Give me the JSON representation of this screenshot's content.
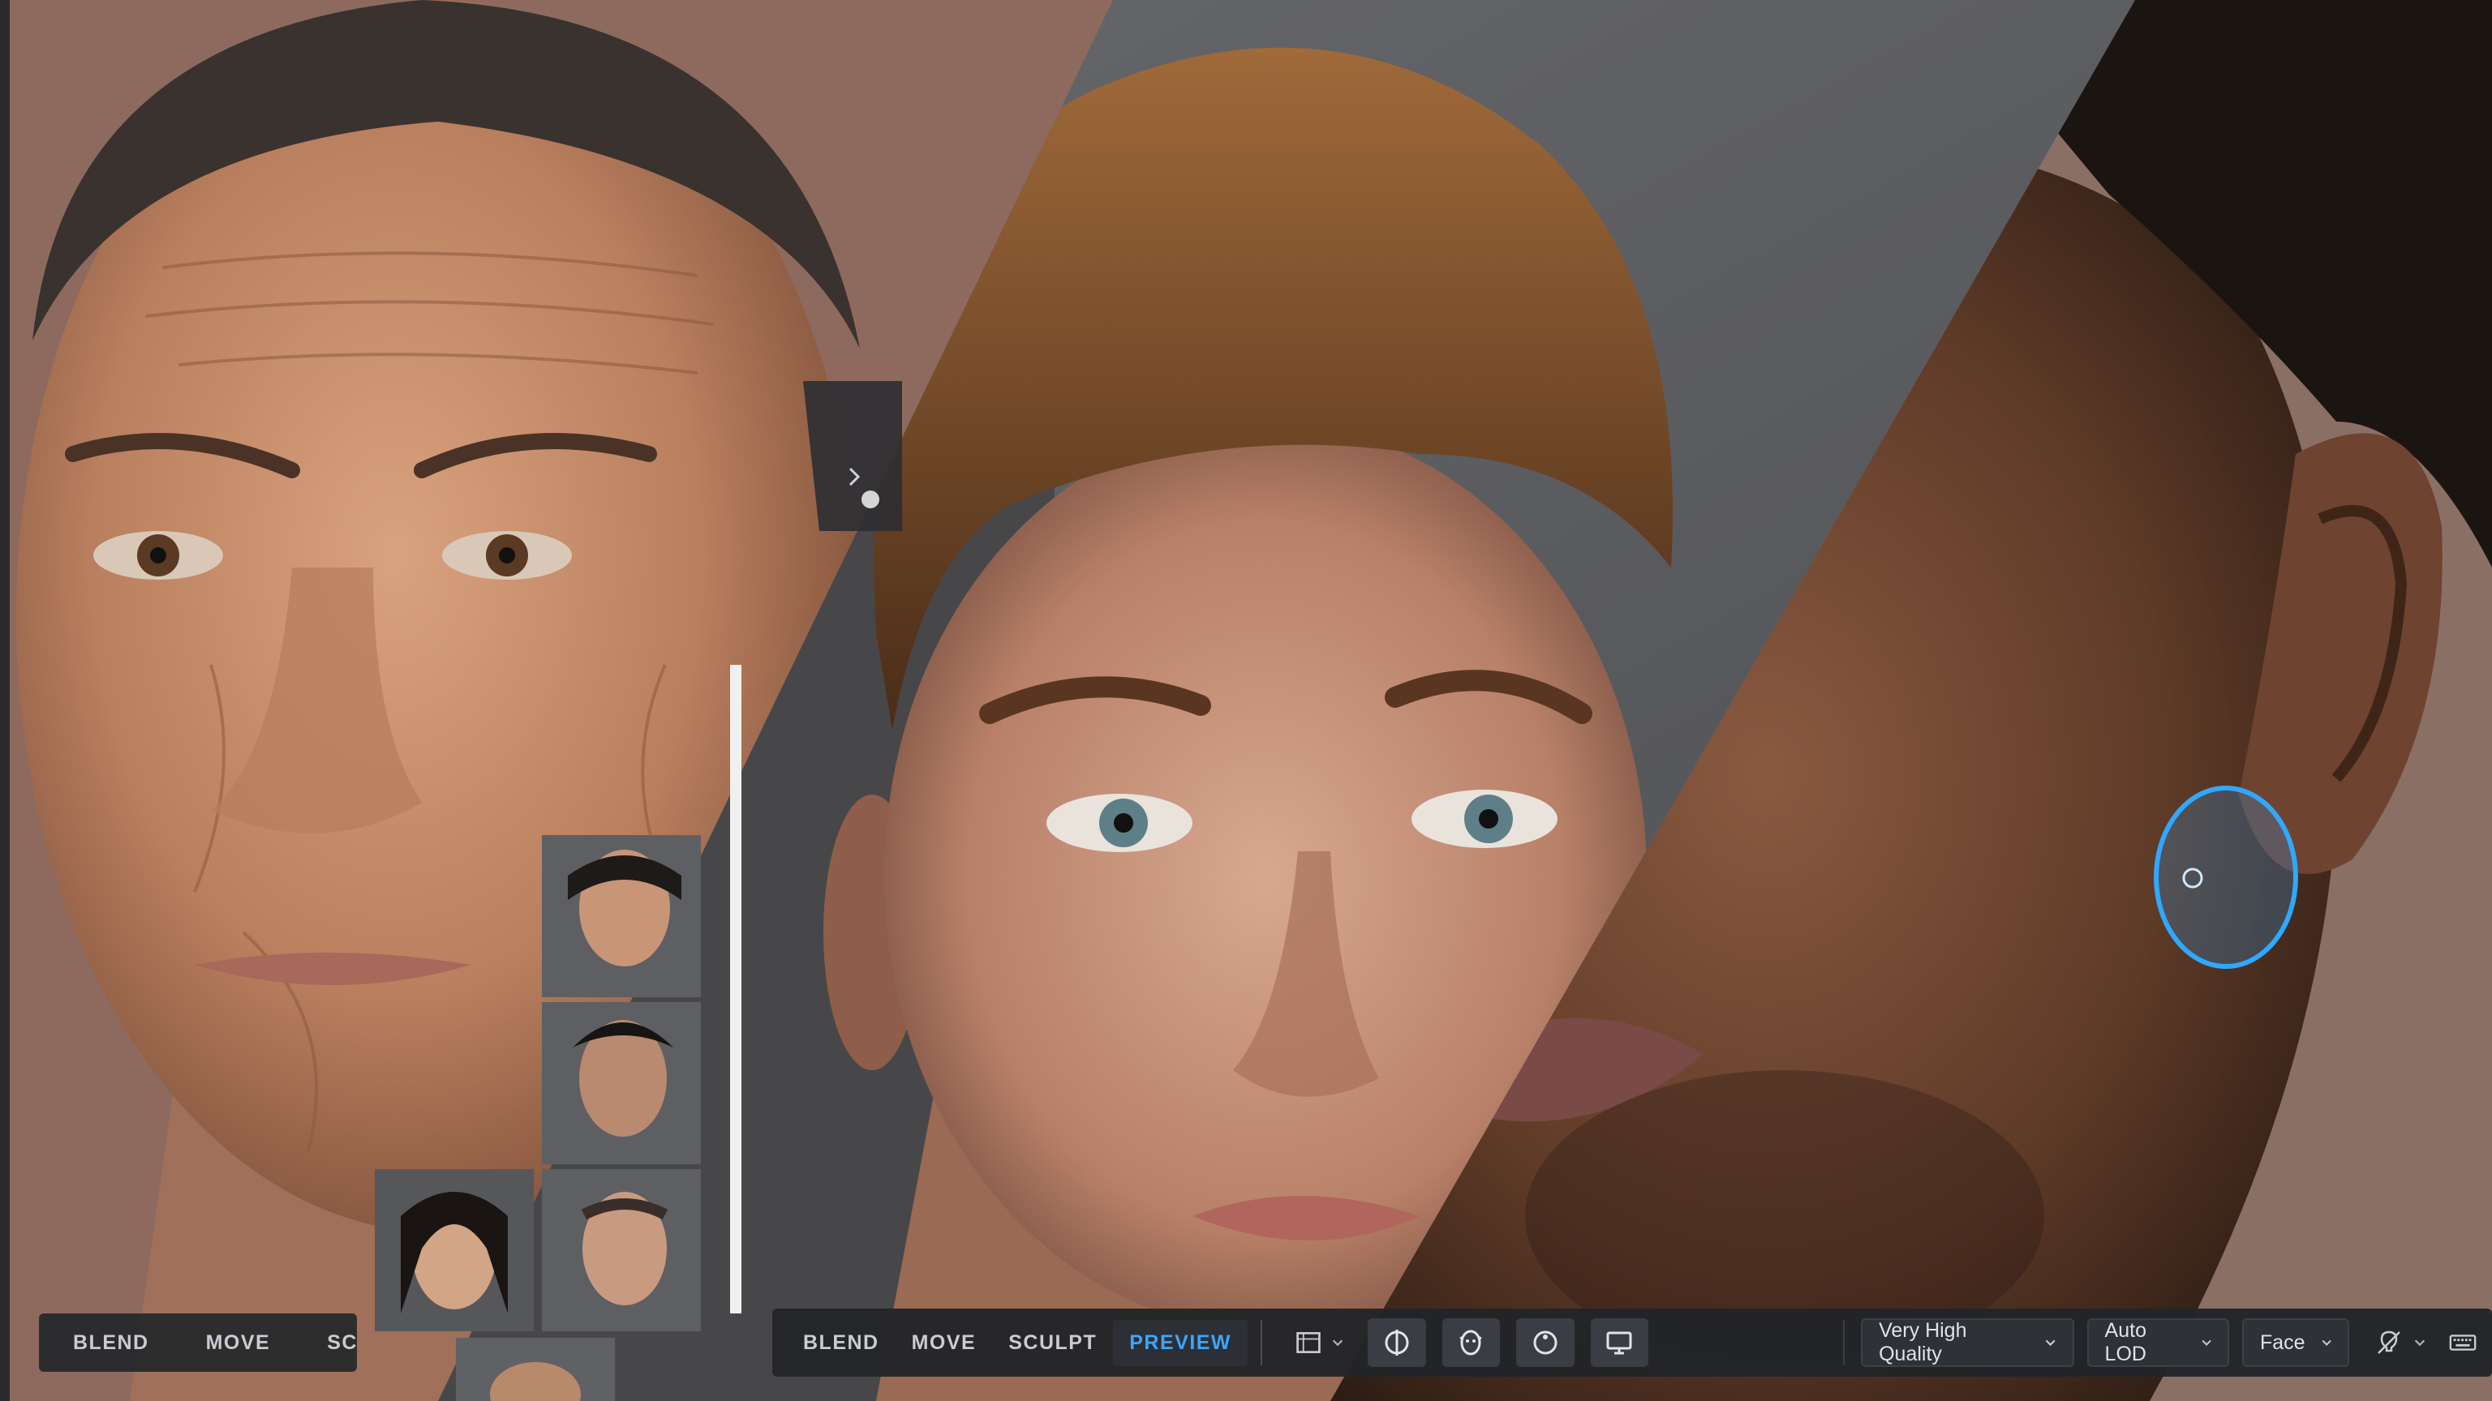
{
  "left_toolbar": {
    "modes": [
      "BLEND",
      "MOVE",
      "SCULPT"
    ]
  },
  "main_toolbar": {
    "modes": [
      "BLEND",
      "MOVE",
      "SCULPT",
      "PREVIEW"
    ],
    "active_mode": "PREVIEW",
    "view_buttons": [
      "frame-icon",
      "target-icon",
      "face-outline-icon",
      "circle-dot-icon",
      "monitor-icon"
    ],
    "quality": "Very High Quality",
    "lod": "Auto LOD",
    "region": "Face",
    "lighting_icon": "lightbulb-icon",
    "keyboard_icon": "keyboard-icon"
  },
  "colors": {
    "accent": "#3aa6ff",
    "toolbar_bg": "#26282c",
    "gizmo": "#2fa8ff"
  }
}
